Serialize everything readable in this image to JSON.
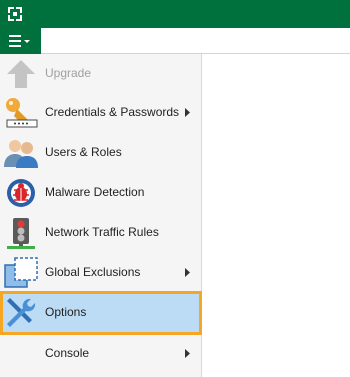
{
  "colors": {
    "brand_green": "#00703c",
    "selection_fill": "#bcdcf5",
    "selection_border": "#f5a623",
    "menu_background": "#f5f5f5"
  },
  "titlebar": {
    "icon": "app-logo-icon"
  },
  "main_menu": {
    "icon": "hamburger-dropdown-icon"
  },
  "menu": {
    "items": [
      {
        "label": "Upgrade",
        "icon": "upgrade-arrow-icon",
        "disabled": true,
        "submenu": false
      },
      {
        "label": "Credentials & Passwords",
        "icon": "key-icon",
        "disabled": false,
        "submenu": true
      },
      {
        "label": "Users & Roles",
        "icon": "users-icon",
        "disabled": false,
        "submenu": false
      },
      {
        "label": "Malware Detection",
        "icon": "malware-bug-icon",
        "disabled": false,
        "submenu": false
      },
      {
        "label": "Network Traffic Rules",
        "icon": "traffic-light-icon",
        "disabled": false,
        "submenu": false
      },
      {
        "label": "Global Exclusions",
        "icon": "exclusions-icon",
        "disabled": false,
        "submenu": true
      },
      {
        "label": "Options",
        "icon": "wrench-screwdriver-icon",
        "disabled": false,
        "submenu": false,
        "selected": true
      },
      {
        "label": "Console",
        "icon": "",
        "disabled": false,
        "submenu": true
      }
    ]
  }
}
